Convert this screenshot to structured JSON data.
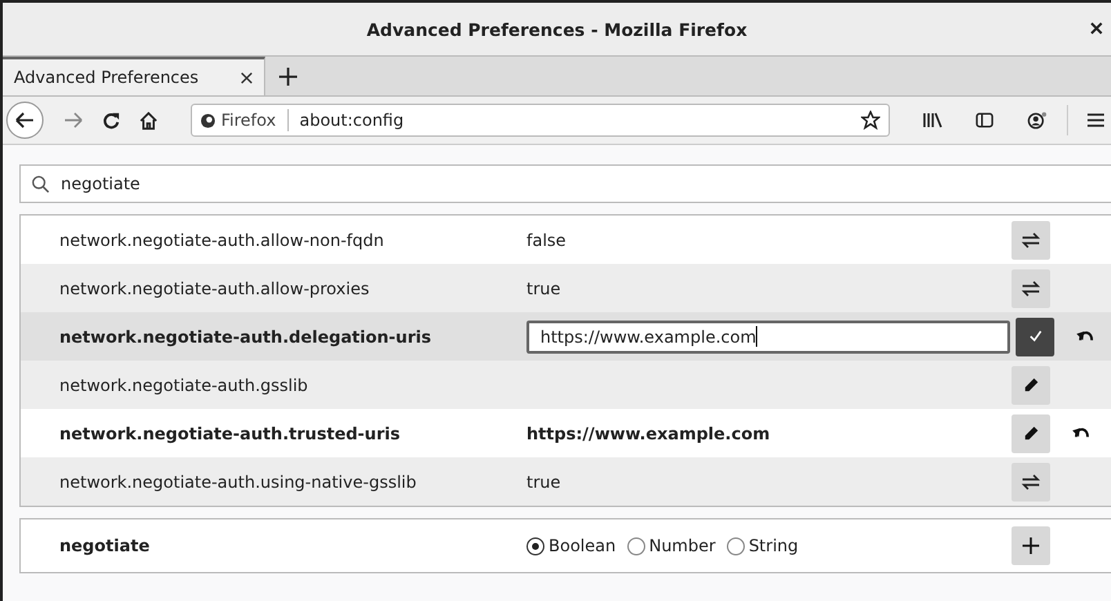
{
  "window": {
    "title": "Advanced Preferences - Mozilla Firefox"
  },
  "tabs": [
    {
      "label": "Advanced Preferences",
      "selected": true
    }
  ],
  "address_bar": {
    "identity": "Firefox",
    "url": "about:config"
  },
  "search": {
    "value": "negotiate"
  },
  "preferences": [
    {
      "name": "network.negotiate-auth.allow-non-fqdn",
      "value": "false",
      "kind": "boolean",
      "modified": false,
      "selected": false
    },
    {
      "name": "network.negotiate-auth.allow-proxies",
      "value": "true",
      "kind": "boolean",
      "modified": false,
      "selected": false
    },
    {
      "name": "network.negotiate-auth.delegation-uris",
      "value": "https://www.example.com",
      "kind": "editing",
      "modified": true,
      "selected": true
    },
    {
      "name": "network.negotiate-auth.gsslib",
      "kind": "string",
      "modified": false,
      "selected": false
    },
    {
      "name": "network.negotiate-auth.trusted-uris",
      "value": "https://www.example.com",
      "kind": "string",
      "modified": true,
      "selected": false
    },
    {
      "name": "network.negotiate-auth.using-native-gsslib",
      "value": "true",
      "kind": "boolean",
      "modified": false,
      "selected": false
    }
  ],
  "new_preference": {
    "name": "negotiate",
    "types": [
      {
        "label": "Boolean",
        "selected": true
      },
      {
        "label": "Number",
        "selected": false
      },
      {
        "label": "String",
        "selected": false
      }
    ]
  }
}
